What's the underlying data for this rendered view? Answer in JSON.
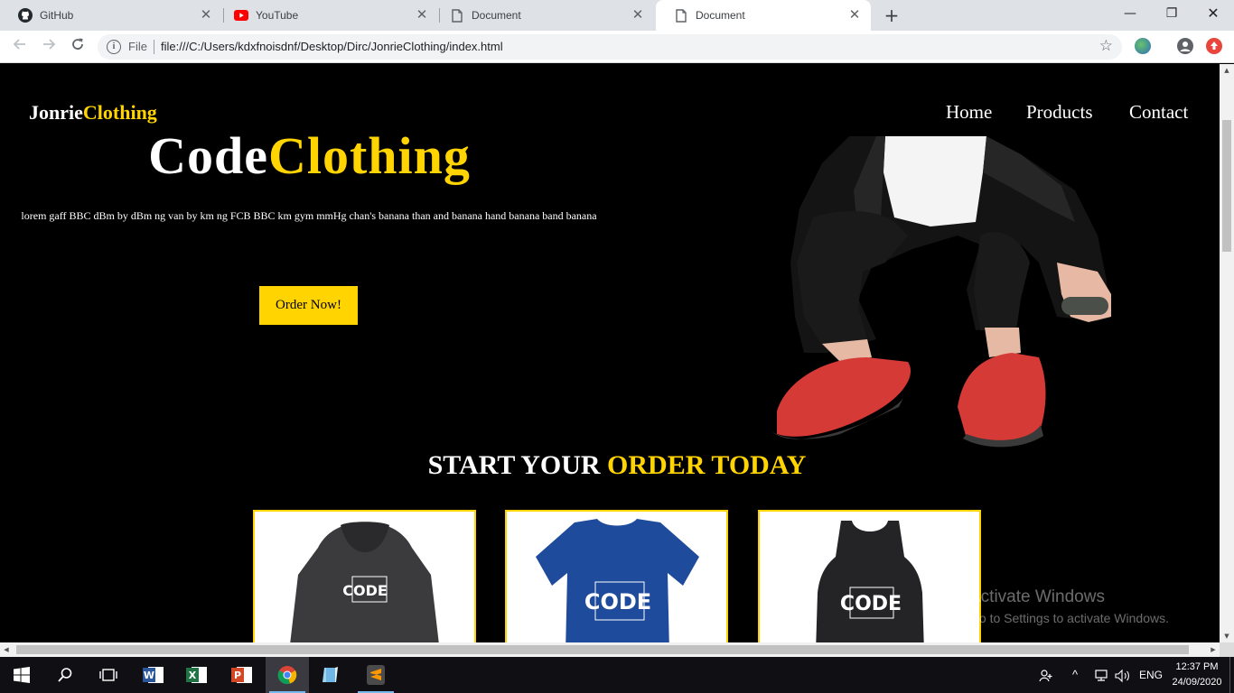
{
  "browser": {
    "tabs": [
      {
        "title": "GitHub",
        "icon": "github-icon"
      },
      {
        "title": "YouTube",
        "icon": "youtube-icon"
      },
      {
        "title": "Document",
        "icon": "document-icon"
      },
      {
        "title": "Document",
        "icon": "document-icon",
        "active": true
      }
    ],
    "new_tab": "+",
    "window_controls": {
      "minimize": "—",
      "restore": "❐",
      "close": "✕"
    },
    "omnibox": {
      "scheme_label": "File",
      "url": "file:///C:/Users/kdxfnoisdnf/Desktop/Dirc/JonrieClothing/index.html"
    }
  },
  "site": {
    "brand": {
      "part1": "Jonrie",
      "part2": "Clothing"
    },
    "nav": [
      "Home",
      "Products",
      "Contact"
    ],
    "hero": {
      "title_part1": "Code",
      "title_part2": "Clothing",
      "text": "lorem gaff BBC dBm by dBm ng van by km ng FCB BBC km gym mmHg chan's banana than and banana hand banana band banana",
      "button": "Order Now!"
    },
    "section": {
      "title_part1": "START YOUR ",
      "title_part2": "ORDER TODAY"
    },
    "products": [
      {
        "type": "hoodie",
        "label": "CODE",
        "color": "#3b3b3d"
      },
      {
        "type": "tshirt",
        "label": "CODE",
        "color": "#1e4b9c"
      },
      {
        "type": "tank-top",
        "label": "CODE",
        "color": "#242426"
      }
    ],
    "accent": "#ffd400"
  },
  "watermark": {
    "line1": "Activate Windows",
    "line2": "Go to Settings to activate Windows."
  },
  "taskbar": {
    "apps": [
      "windows-start-icon",
      "search-icon",
      "task-view-icon",
      "word-icon",
      "excel-icon",
      "powerpoint-icon",
      "chrome-icon",
      "notepad-icon",
      "sublime-text-icon"
    ],
    "language": "ENG",
    "time": "12:37 PM",
    "date": "24/09/2020"
  }
}
